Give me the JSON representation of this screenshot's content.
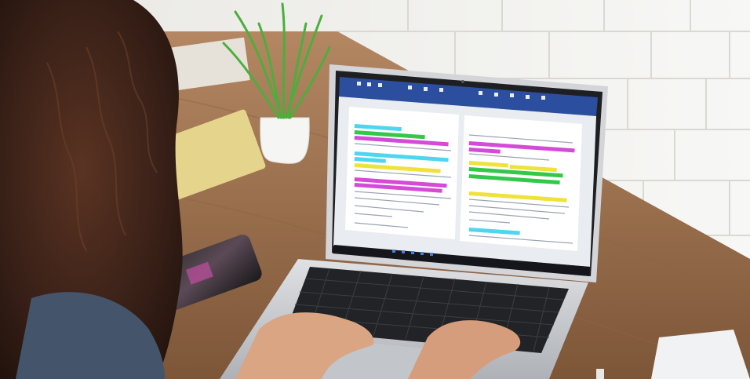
{
  "photo": {
    "subject": "person-typing-on-laptop",
    "colors": {
      "wall": "#f3f3f1",
      "desk": "#9a7152",
      "laptop_body": "#c9ccd1",
      "screen_frame": "#1e1f23",
      "ribbon": "#2b4f9e",
      "highlight_cyan": "#4fd6ef",
      "highlight_magenta": "#d34bd6",
      "highlight_green": "#34c84a",
      "highlight_yellow": "#efe23a",
      "hair": "#3a2118"
    }
  },
  "laptop_screen": {
    "app": "word-processor",
    "tab_count": 2
  }
}
